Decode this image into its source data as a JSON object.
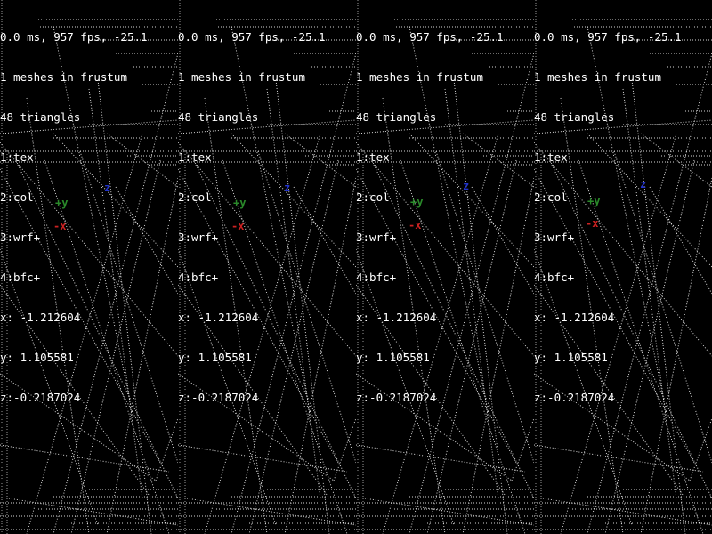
{
  "hud": {
    "line1": "0.0 ms, 957 fps, -25.1",
    "line2": "1 meshes in frustum",
    "line3": "48 triangles",
    "line4": "1:tex-",
    "line5": "2:col-",
    "line6": "3:wrf+",
    "line7": "4:bfc+",
    "line8": "x: -1.212604",
    "line9": "y: 1.105581",
    "line10": "z:-0.2187024"
  },
  "axes": {
    "y_label": "+y",
    "z_label": "z",
    "x_label": "-x",
    "y_color": "#2a8a2a",
    "z_color": "#2233cc",
    "x_color": "#cc2222"
  },
  "wire_color": "#ffffff",
  "panel_count": 4
}
